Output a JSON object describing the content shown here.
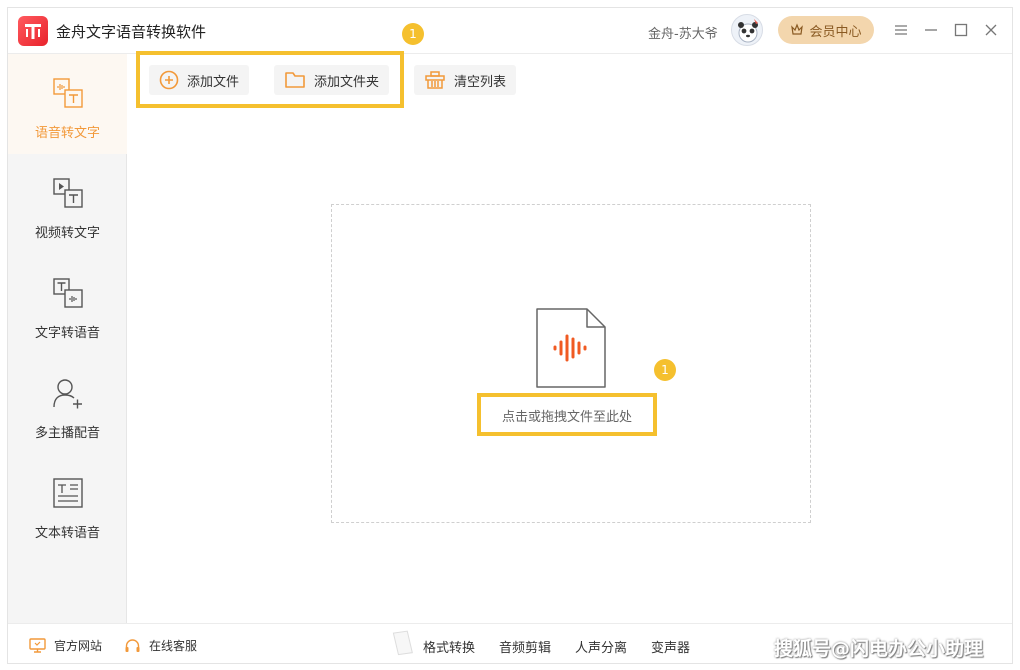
{
  "app": {
    "title": "金舟文字语音转换软件"
  },
  "header": {
    "username": "金舟-苏大爷",
    "vip_label": "会员中心"
  },
  "sidebar": {
    "items": [
      {
        "label": "语音转文字",
        "active": true
      },
      {
        "label": "视频转文字"
      },
      {
        "label": "文字转语音"
      },
      {
        "label": "多主播配音"
      },
      {
        "label": "文本转语音"
      }
    ]
  },
  "toolbar": {
    "add_file": "添加文件",
    "add_folder": "添加文件夹",
    "clear_list": "清空列表"
  },
  "annotations": {
    "badge_top": "1",
    "badge_drop": "1"
  },
  "dropzone": {
    "hint": "点击或拖拽文件至此处"
  },
  "footer": {
    "website": "官方网站",
    "support": "在线客服",
    "tools": [
      "格式转换",
      "音频剪辑",
      "人声分离",
      "变声器"
    ],
    "watermark": "搜狐号@闪电办公小助理"
  },
  "colors": {
    "accent": "#f2993a",
    "highlight": "#f5c02e",
    "vip": "#f3d6ad",
    "logo": "#e8222b"
  }
}
